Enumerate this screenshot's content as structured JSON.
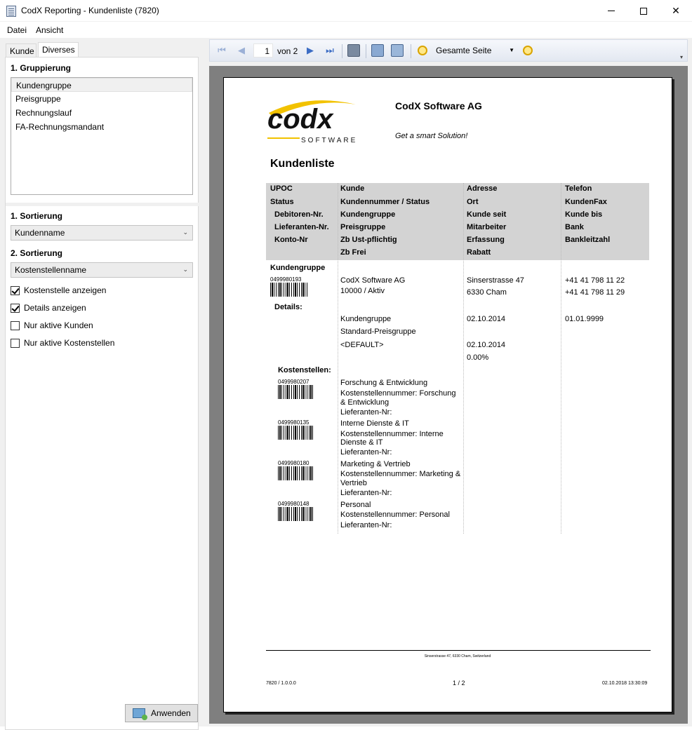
{
  "window": {
    "title": "CodX Reporting - Kundenliste (7820)"
  },
  "menu": [
    "Datei",
    "Ansicht"
  ],
  "left": {
    "tabs": [
      "Kunde",
      "Diverses"
    ],
    "grouping": {
      "heading": "1. Gruppierung",
      "items": [
        "Kundengruppe",
        "Preisgruppe",
        "Rechnungslauf",
        "FA-Rechnungsmandant"
      ],
      "selected": "Kundengruppe"
    },
    "sort1": {
      "heading": "1. Sortierung",
      "value": "Kundenname"
    },
    "sort2": {
      "heading": "2. Sortierung",
      "value": "Kostenstellenname"
    },
    "checks": [
      {
        "label": "Kostenstelle anzeigen",
        "checked": true
      },
      {
        "label": "Details anzeigen",
        "checked": true
      },
      {
        "label": "Nur aktive Kunden",
        "checked": false
      },
      {
        "label": "Nur aktive Kostenstellen",
        "checked": false
      }
    ],
    "apply_label": "Anwenden"
  },
  "toolbar": {
    "page": "1",
    "of_label": "von 2",
    "zoom": "Gesamte Seite"
  },
  "report": {
    "company": "CodX Software AG",
    "slogan": "Get a smart Solution!",
    "logo_text": "codx",
    "logo_sub": "SOFTWARE",
    "title": "Kundenliste",
    "header": {
      "col1": [
        "UPOC",
        "Status",
        "Debitoren-Nr.",
        "Lieferanten-Nr.",
        "Konto-Nr"
      ],
      "col2": [
        "Kunde",
        "Kundennummer / Status",
        "Kundengruppe",
        "Preisgruppe",
        "Zb Ust-pflichtig",
        "Zb Frei"
      ],
      "col3": [
        "Adresse",
        "Ort",
        "Kunde seit",
        "Mitarbeiter",
        "Erfassung",
        "Rabatt"
      ],
      "col4": [
        "Telefon",
        "KundenFax",
        "Kunde bis",
        "Bank",
        "Bankleitzahl"
      ]
    },
    "group_label": "Kundengruppe",
    "customer": {
      "upoc": "0499980193",
      "name": "CodX Software AG",
      "number_status": "10000 / Aktiv",
      "street": "Sinserstrasse 47",
      "city": "6330 Cham",
      "phone": "+41 41 798 11 22",
      "fax": "+41 41 798 11 29"
    },
    "details_label": "Details:",
    "details": {
      "group": "Kundengruppe",
      "since": "02.10.2014",
      "until": "01.01.9999",
      "price_group": "Standard-Preisgruppe",
      "default": "<DEFAULT>",
      "entry": "02.10.2014",
      "discount": "0.00%"
    },
    "costcenters_label": "Kostenstellen:",
    "costcenters": [
      {
        "code": "0499980207",
        "name": "Forschung & Entwicklung",
        "number_l1": "Kostenstellennummer: Forschung",
        "number_l2": "& Entwicklung",
        "supplier": "Lieferanten-Nr:"
      },
      {
        "code": "0499980135",
        "name": "Interne Dienste & IT",
        "number_l1": "Kostenstellennummer: Interne",
        "number_l2": "Dienste & IT",
        "supplier": "Lieferanten-Nr:"
      },
      {
        "code": "0499980180",
        "name": "Marketing & Vertrieb",
        "number_l1": "Kostenstellennummer: Marketing &",
        "number_l2": "Vertrieb",
        "supplier": "Lieferanten-Nr:"
      },
      {
        "code": "0499980148",
        "name": "Personal",
        "number_l1": "Kostenstellennummer: Personal",
        "number_l2": "",
        "supplier": "Lieferanten-Nr:"
      }
    ],
    "footer": {
      "address": "Sinserstrasse 47, 6330 Cham, Switzerland",
      "version": "7820 / 1.0.0.0",
      "page": "1 / 2",
      "timestamp": "02.10.2018 13:30:09"
    }
  }
}
